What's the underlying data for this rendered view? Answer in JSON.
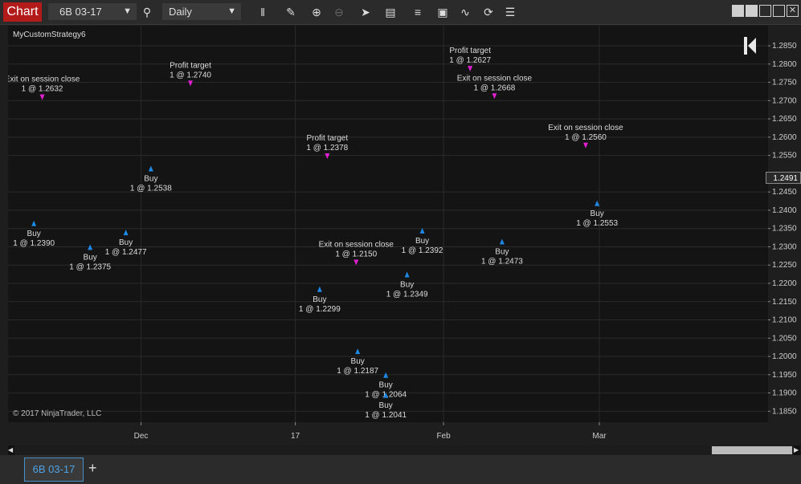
{
  "toolbar": {
    "chart_tab_label": "Chart",
    "instrument": "6B 03-17",
    "period": "Daily",
    "icons": [
      "search-icon",
      "bars-type-icon",
      "pencil-icon",
      "zoom-in-icon",
      "zoom-out-icon",
      "pointer-icon",
      "data-box-icon",
      "indicators-icon",
      "strategies-icon",
      "drawing-tools-icon",
      "refresh-icon",
      "properties-icon"
    ]
  },
  "chart": {
    "strategy_name": "MyCustomStrategy6",
    "copyright": "© 2017 NinjaTrader, LLC",
    "last_price": "1.2491",
    "instrument_tab": "6B 03-17",
    "add_tab": "+"
  },
  "chart_data": {
    "type": "ohlc",
    "price_axis_ticks": [
      "1.2850",
      "1.2800",
      "1.2750",
      "1.2700",
      "1.2650",
      "1.2600",
      "1.2550",
      "1.2450",
      "1.2400",
      "1.2350",
      "1.2300",
      "1.2250",
      "1.2200",
      "1.2150",
      "1.2100",
      "1.2050",
      "1.2000",
      "1.1950",
      "1.1900",
      "1.1850"
    ],
    "ylim": [
      1.182,
      1.2905
    ],
    "time_axis_ticks": [
      "Dec",
      "17",
      "Feb",
      "Mar"
    ],
    "annotations": [
      {
        "text": "Profit target",
        "price_label": "1 @ 1.2740",
        "y": 1.279,
        "x": 0.24
      },
      {
        "text": "Exit on session close",
        "price_label": "1 @ 1.2632",
        "y": 1.2752,
        "x": 0.045
      },
      {
        "text": "Profit target",
        "price_label": "1 @ 1.2378",
        "y": 1.2591,
        "x": 0.42
      },
      {
        "text": "Profit target",
        "price_label": "1 @ 1.2627",
        "y": 1.283,
        "x": 0.608
      },
      {
        "text": "Exit on session close",
        "price_label": "1 @ 1.2668",
        "y": 1.2755,
        "x": 0.64
      },
      {
        "text": "Exit on session close",
        "price_label": "1 @ 1.2560",
        "y": 1.262,
        "x": 0.76
      },
      {
        "text": "Buy",
        "price_label": "1 @ 1.2390",
        "y": 1.233,
        "x": 0.034
      },
      {
        "text": "Buy",
        "price_label": "1 @ 1.2538",
        "y": 1.248,
        "x": 0.188
      },
      {
        "text": "Buy",
        "price_label": "1 @ 1.2477",
        "y": 1.2305,
        "x": 0.155
      },
      {
        "text": "Buy",
        "price_label": "1 @ 1.2375",
        "y": 1.2265,
        "x": 0.108
      },
      {
        "text": "Buy",
        "price_label": "1 @ 1.2187",
        "y": 1.198,
        "x": 0.46
      },
      {
        "text": "Buy",
        "price_label": "1 @ 1.2064",
        "y": 1.1915,
        "x": 0.497
      },
      {
        "text": "Buy",
        "price_label": "1 @ 1.2041",
        "y": 1.186,
        "x": 0.497
      },
      {
        "text": "Buy",
        "price_label": "1 @ 1.2473",
        "y": 1.228,
        "x": 0.65
      },
      {
        "text": "Buy",
        "price_label": "1 @ 1.2553",
        "y": 1.2385,
        "x": 0.775
      },
      {
        "text": "Buy",
        "price_label": "1 @ 1.2392",
        "y": 1.231,
        "x": 0.545
      },
      {
        "text": "Buy",
        "price_label": "1 @ 1.2299",
        "y": 1.215,
        "x": 0.41
      },
      {
        "text": "Exit on session close",
        "price_label": "1 @ 1.2150",
        "y": 1.23,
        "x": 0.458
      },
      {
        "text": "Buy",
        "price_label": "1 @ 1.2349",
        "y": 1.219,
        "x": 0.525
      }
    ]
  }
}
